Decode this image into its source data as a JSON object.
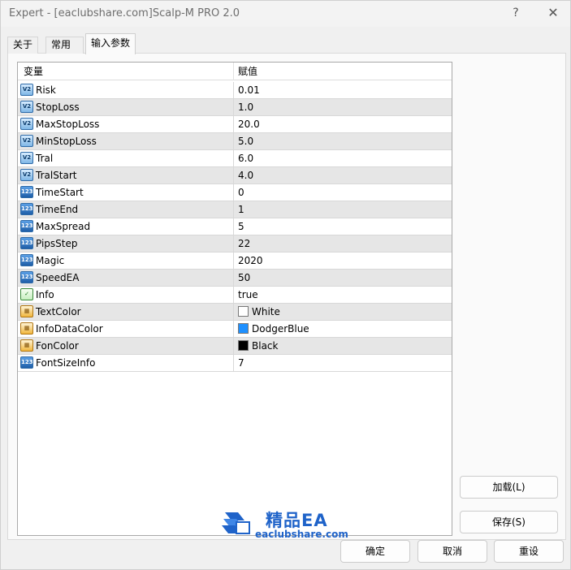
{
  "window": {
    "title": "Expert - [eaclubshare.com]Scalp-M PRO 2.0",
    "help_glyph": "?",
    "close_glyph": "✕"
  },
  "tabs": [
    {
      "label": "关于"
    },
    {
      "label": "常用"
    },
    {
      "label": "输入参数",
      "active": true
    }
  ],
  "grid": {
    "headers": {
      "variable": "变量",
      "value": "赋值"
    },
    "rows": [
      {
        "type": "double",
        "icon": "double-type-icon",
        "name": "Risk",
        "value": "0.01"
      },
      {
        "type": "double",
        "icon": "double-type-icon",
        "name": "StopLoss",
        "value": "1.0"
      },
      {
        "type": "double",
        "icon": "double-type-icon",
        "name": "MaxStopLoss",
        "value": "20.0"
      },
      {
        "type": "double",
        "icon": "double-type-icon",
        "name": "MinStopLoss",
        "value": "5.0"
      },
      {
        "type": "double",
        "icon": "double-type-icon",
        "name": "Tral",
        "value": "6.0"
      },
      {
        "type": "double",
        "icon": "double-type-icon",
        "name": "TralStart",
        "value": "4.0"
      },
      {
        "type": "int",
        "icon": "integer-type-icon",
        "name": "TimeStart",
        "value": "0"
      },
      {
        "type": "int",
        "icon": "integer-type-icon",
        "name": "TimeEnd",
        "value": "1"
      },
      {
        "type": "int",
        "icon": "integer-type-icon",
        "name": "MaxSpread",
        "value": "5"
      },
      {
        "type": "int",
        "icon": "integer-type-icon",
        "name": "PipsStep",
        "value": "22"
      },
      {
        "type": "int",
        "icon": "integer-type-icon",
        "name": "Magic",
        "value": "2020"
      },
      {
        "type": "int",
        "icon": "integer-type-icon",
        "name": "SpeedEA",
        "value": "50"
      },
      {
        "type": "bool",
        "icon": "boolean-type-icon",
        "name": "Info",
        "value": "true"
      },
      {
        "type": "color",
        "icon": "color-type-icon",
        "name": "TextColor",
        "value": "White",
        "swatch": "#ffffff"
      },
      {
        "type": "color",
        "icon": "color-type-icon",
        "name": "InfoDataColor",
        "value": "DodgerBlue",
        "swatch": "#1e90ff"
      },
      {
        "type": "color",
        "icon": "color-type-icon",
        "name": "FonColor",
        "value": "Black",
        "swatch": "#000000"
      },
      {
        "type": "int",
        "icon": "integer-type-icon",
        "name": "FontSizeInfo",
        "value": "7"
      }
    ]
  },
  "buttons": {
    "load": "加载(L)",
    "save": "保存(S)",
    "ok": "确定",
    "cancel": "取消",
    "reset": "重设"
  },
  "watermark": {
    "title": "精品EA",
    "url": "eaclubshare.com"
  },
  "colors": {
    "brand": "#1f63c9",
    "row_alt": "#e6e6e6"
  }
}
